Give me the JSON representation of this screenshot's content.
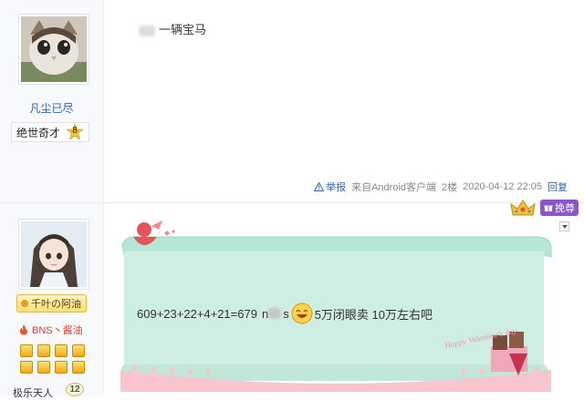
{
  "post1": {
    "username": "凡尘已尽",
    "title_badge": "绝世奇才",
    "level": "8",
    "content": "一辆宝马",
    "report_label": "举报",
    "client": "来自Android客户端",
    "floor": "2楼",
    "timestamp": "2020-04-12 22:05",
    "reply_label": "回复"
  },
  "post2": {
    "fan_badge": "千叶の阿油",
    "tag_text": "BNS丶酱油",
    "vip_label": "挽尊",
    "content_before": "609+23+22+4+21=679",
    "content_partial": "n",
    "content_mid": "s",
    "content_after": "5万闭眼卖 10万左右吧",
    "stamp_text": "Happy Valentine's day"
  },
  "next_user": {
    "name": "极乐天人",
    "level": "12"
  },
  "colors": {
    "link": "#2d64b3",
    "vip": "#8a56c9",
    "note_bg": "#cfeee3",
    "note_border": "#9fd7c2",
    "lace": "#f7c5cf"
  }
}
